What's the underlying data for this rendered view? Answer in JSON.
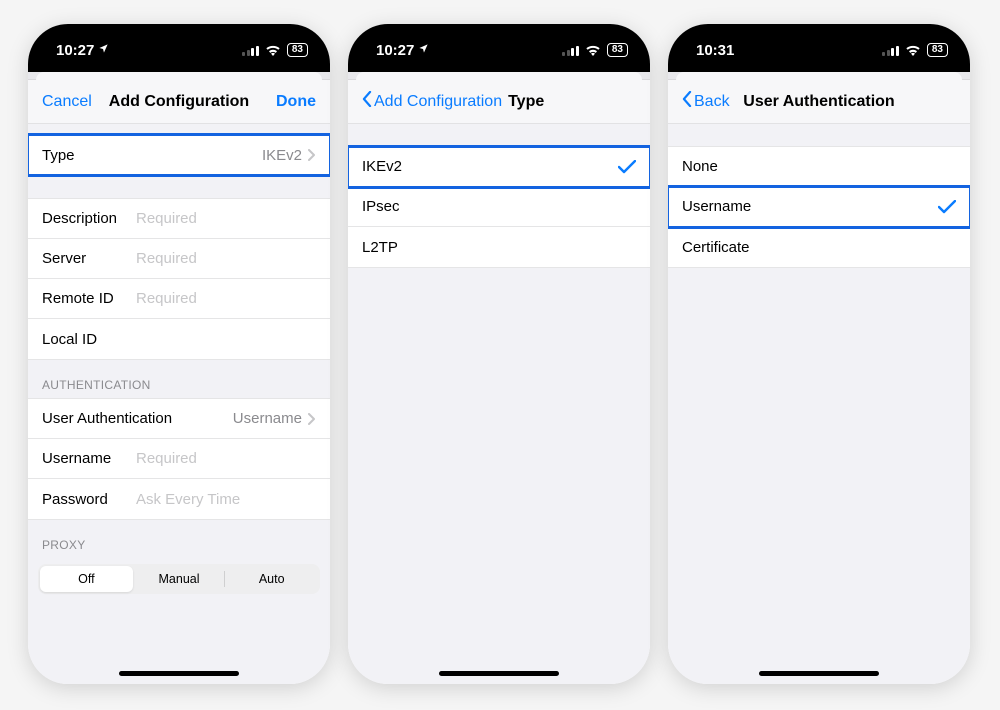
{
  "statusbar": {
    "time_a": "10:27",
    "time_b": "10:27",
    "time_c": "10:31",
    "battery": "83"
  },
  "phone1": {
    "nav": {
      "left": "Cancel",
      "title": "Add Configuration",
      "right": "Done"
    },
    "type_row": {
      "label": "Type",
      "value": "IKEv2"
    },
    "fields": {
      "description": {
        "label": "Description",
        "placeholder": "Required"
      },
      "server": {
        "label": "Server",
        "placeholder": "Required"
      },
      "remote_id": {
        "label": "Remote ID",
        "placeholder": "Required"
      },
      "local_id": {
        "label": "Local ID",
        "placeholder": ""
      }
    },
    "auth_header": "Authentication",
    "auth": {
      "user_auth": {
        "label": "User Authentication",
        "value": "Username"
      },
      "username": {
        "label": "Username",
        "placeholder": "Required"
      },
      "password": {
        "label": "Password",
        "placeholder": "Ask Every Time"
      }
    },
    "proxy_header": "Proxy",
    "proxy": {
      "options": [
        "Off",
        "Manual",
        "Auto"
      ],
      "selected": "Off"
    }
  },
  "phone2": {
    "nav": {
      "back": "Add Configuration",
      "title": "Type"
    },
    "options": {
      "ikev2": "IKEv2",
      "ipsec": "IPsec",
      "l2tp": "L2TP"
    },
    "selected": "ikev2"
  },
  "phone3": {
    "nav": {
      "back": "Back",
      "title": "User Authentication"
    },
    "options": {
      "none": "None",
      "username": "Username",
      "certificate": "Certificate"
    },
    "selected": "username"
  }
}
